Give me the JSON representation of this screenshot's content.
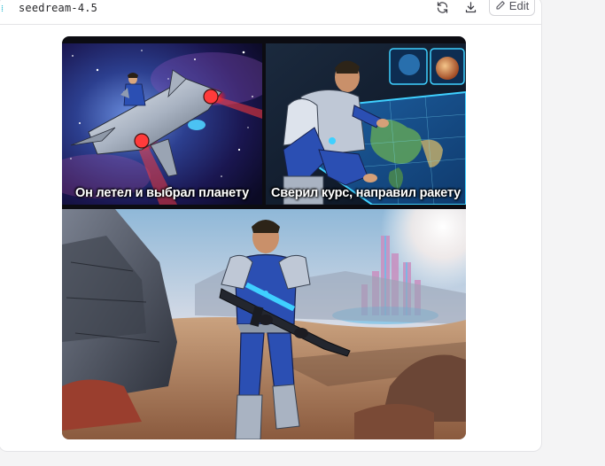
{
  "header": {
    "model_name": "seedream-4.5",
    "refresh_label": "",
    "download_label": "",
    "edit_label": "Edit"
  },
  "comic": {
    "panels": [
      {
        "caption": "Он летел и выбрал планету",
        "scene": "spaceship-in-starfield"
      },
      {
        "caption": "Сверил курс, направил ракету",
        "scene": "astronaut-at-holographic-map"
      },
      {
        "caption": "",
        "scene": "astronaut-with-rifle-on-alien-planet"
      }
    ]
  },
  "colors": {
    "accent": "#22b8cf",
    "suit_blue": "#2b4fb3",
    "hologram": "#3fd0ff"
  }
}
